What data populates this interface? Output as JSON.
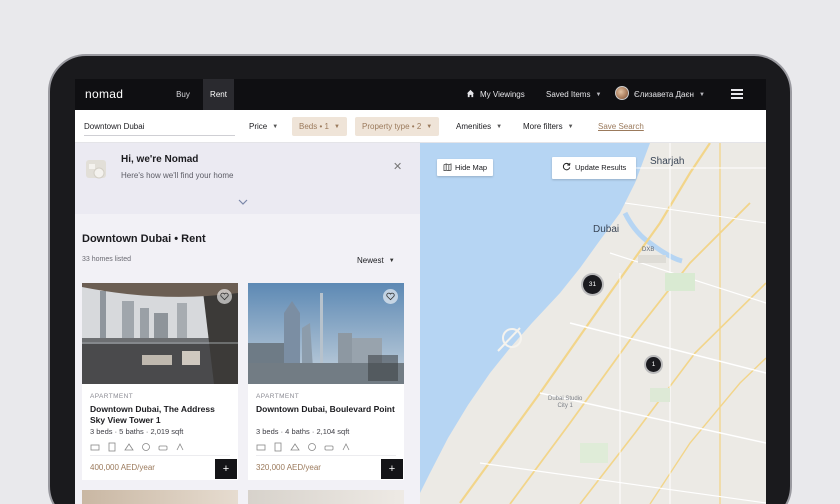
{
  "nav": {
    "logo": "nomad",
    "tabs": [
      {
        "label": "Buy"
      },
      {
        "label": "Rent",
        "active": true
      }
    ],
    "viewings": "My Viewings",
    "saved_items": "Saved Items",
    "user_name": "Єлизавета Даєн"
  },
  "filters": {
    "search_value": "Downtown Dubai",
    "price": "Price",
    "beds": "Beds • 1",
    "property_type": "Property type • 2",
    "amenities": "Amenities",
    "more_filters": "More filters",
    "save_search": "Save Search"
  },
  "welcome": {
    "title": "Hi, we're Nomad",
    "subtitle": "Here's how we'll find your home"
  },
  "results": {
    "title": "Downtown Dubai • Rent",
    "count": "33 homes listed",
    "sort": "Newest"
  },
  "listings": [
    {
      "type": "APARTMENT",
      "title": "Downtown Dubai, The Address Sky View Tower 1",
      "specs": "3 beds · 5 baths · 2,019 sqft",
      "price": "400,000 AED/year"
    },
    {
      "type": "APARTMENT",
      "title": "Downtown Dubai, Boulevard Point",
      "specs": "3 beds · 4 baths · 2,104 sqft",
      "price": "320,000 AED/year"
    }
  ],
  "map": {
    "hide_map": "Hide Map",
    "update_results": "Update Results",
    "labels": {
      "sharjah": "Sharjah",
      "dubai": "Dubai",
      "dxb": "DXB",
      "studio_line1": "Dubai Studio",
      "studio_line2": "City 1"
    },
    "clusters": [
      {
        "count": "31"
      },
      {
        "count": "1"
      }
    ]
  },
  "colors": {
    "accent": "#9b7a5c",
    "nav_bg": "#0f0f12",
    "water": "#b6d5f3",
    "land": "#eceae5"
  }
}
